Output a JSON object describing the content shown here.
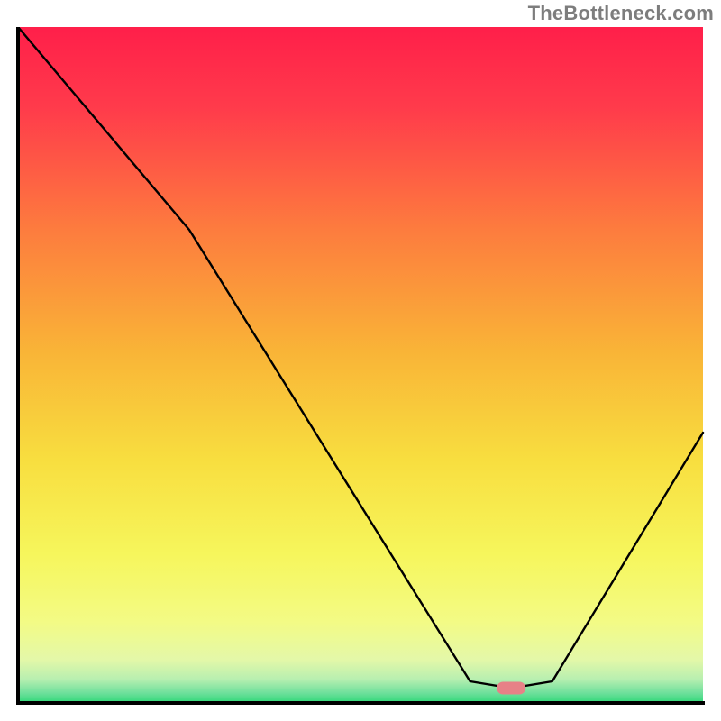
{
  "watermark": "TheBottleneck.com",
  "chart_data": {
    "type": "line",
    "title": "",
    "xlabel": "",
    "ylabel": "",
    "xlim": [
      0,
      100
    ],
    "ylim": [
      0,
      100
    ],
    "series": [
      {
        "name": "bottleneck-curve",
        "x": [
          0,
          25,
          66,
          72,
          78,
          100
        ],
        "values": [
          100,
          70,
          3.2,
          2.2,
          3.2,
          40
        ]
      }
    ],
    "annotations": [
      {
        "name": "optimal-marker",
        "x": 72,
        "y": 2.2,
        "color": "#e78187"
      }
    ],
    "gradient_stops": [
      {
        "offset": 0.0,
        "color": "#ff1f4a"
      },
      {
        "offset": 0.12,
        "color": "#ff3b4b"
      },
      {
        "offset": 0.3,
        "color": "#fd7c3e"
      },
      {
        "offset": 0.48,
        "color": "#f9b437"
      },
      {
        "offset": 0.64,
        "color": "#f8de3f"
      },
      {
        "offset": 0.78,
        "color": "#f6f65c"
      },
      {
        "offset": 0.88,
        "color": "#f3fb85"
      },
      {
        "offset": 0.935,
        "color": "#e4f8a8"
      },
      {
        "offset": 0.965,
        "color": "#b7efb0"
      },
      {
        "offset": 0.985,
        "color": "#6fe09c"
      },
      {
        "offset": 1.0,
        "color": "#2fd878"
      }
    ],
    "axis_color": "#000000",
    "curve_color": "#000000",
    "curve_width": 2.4
  }
}
